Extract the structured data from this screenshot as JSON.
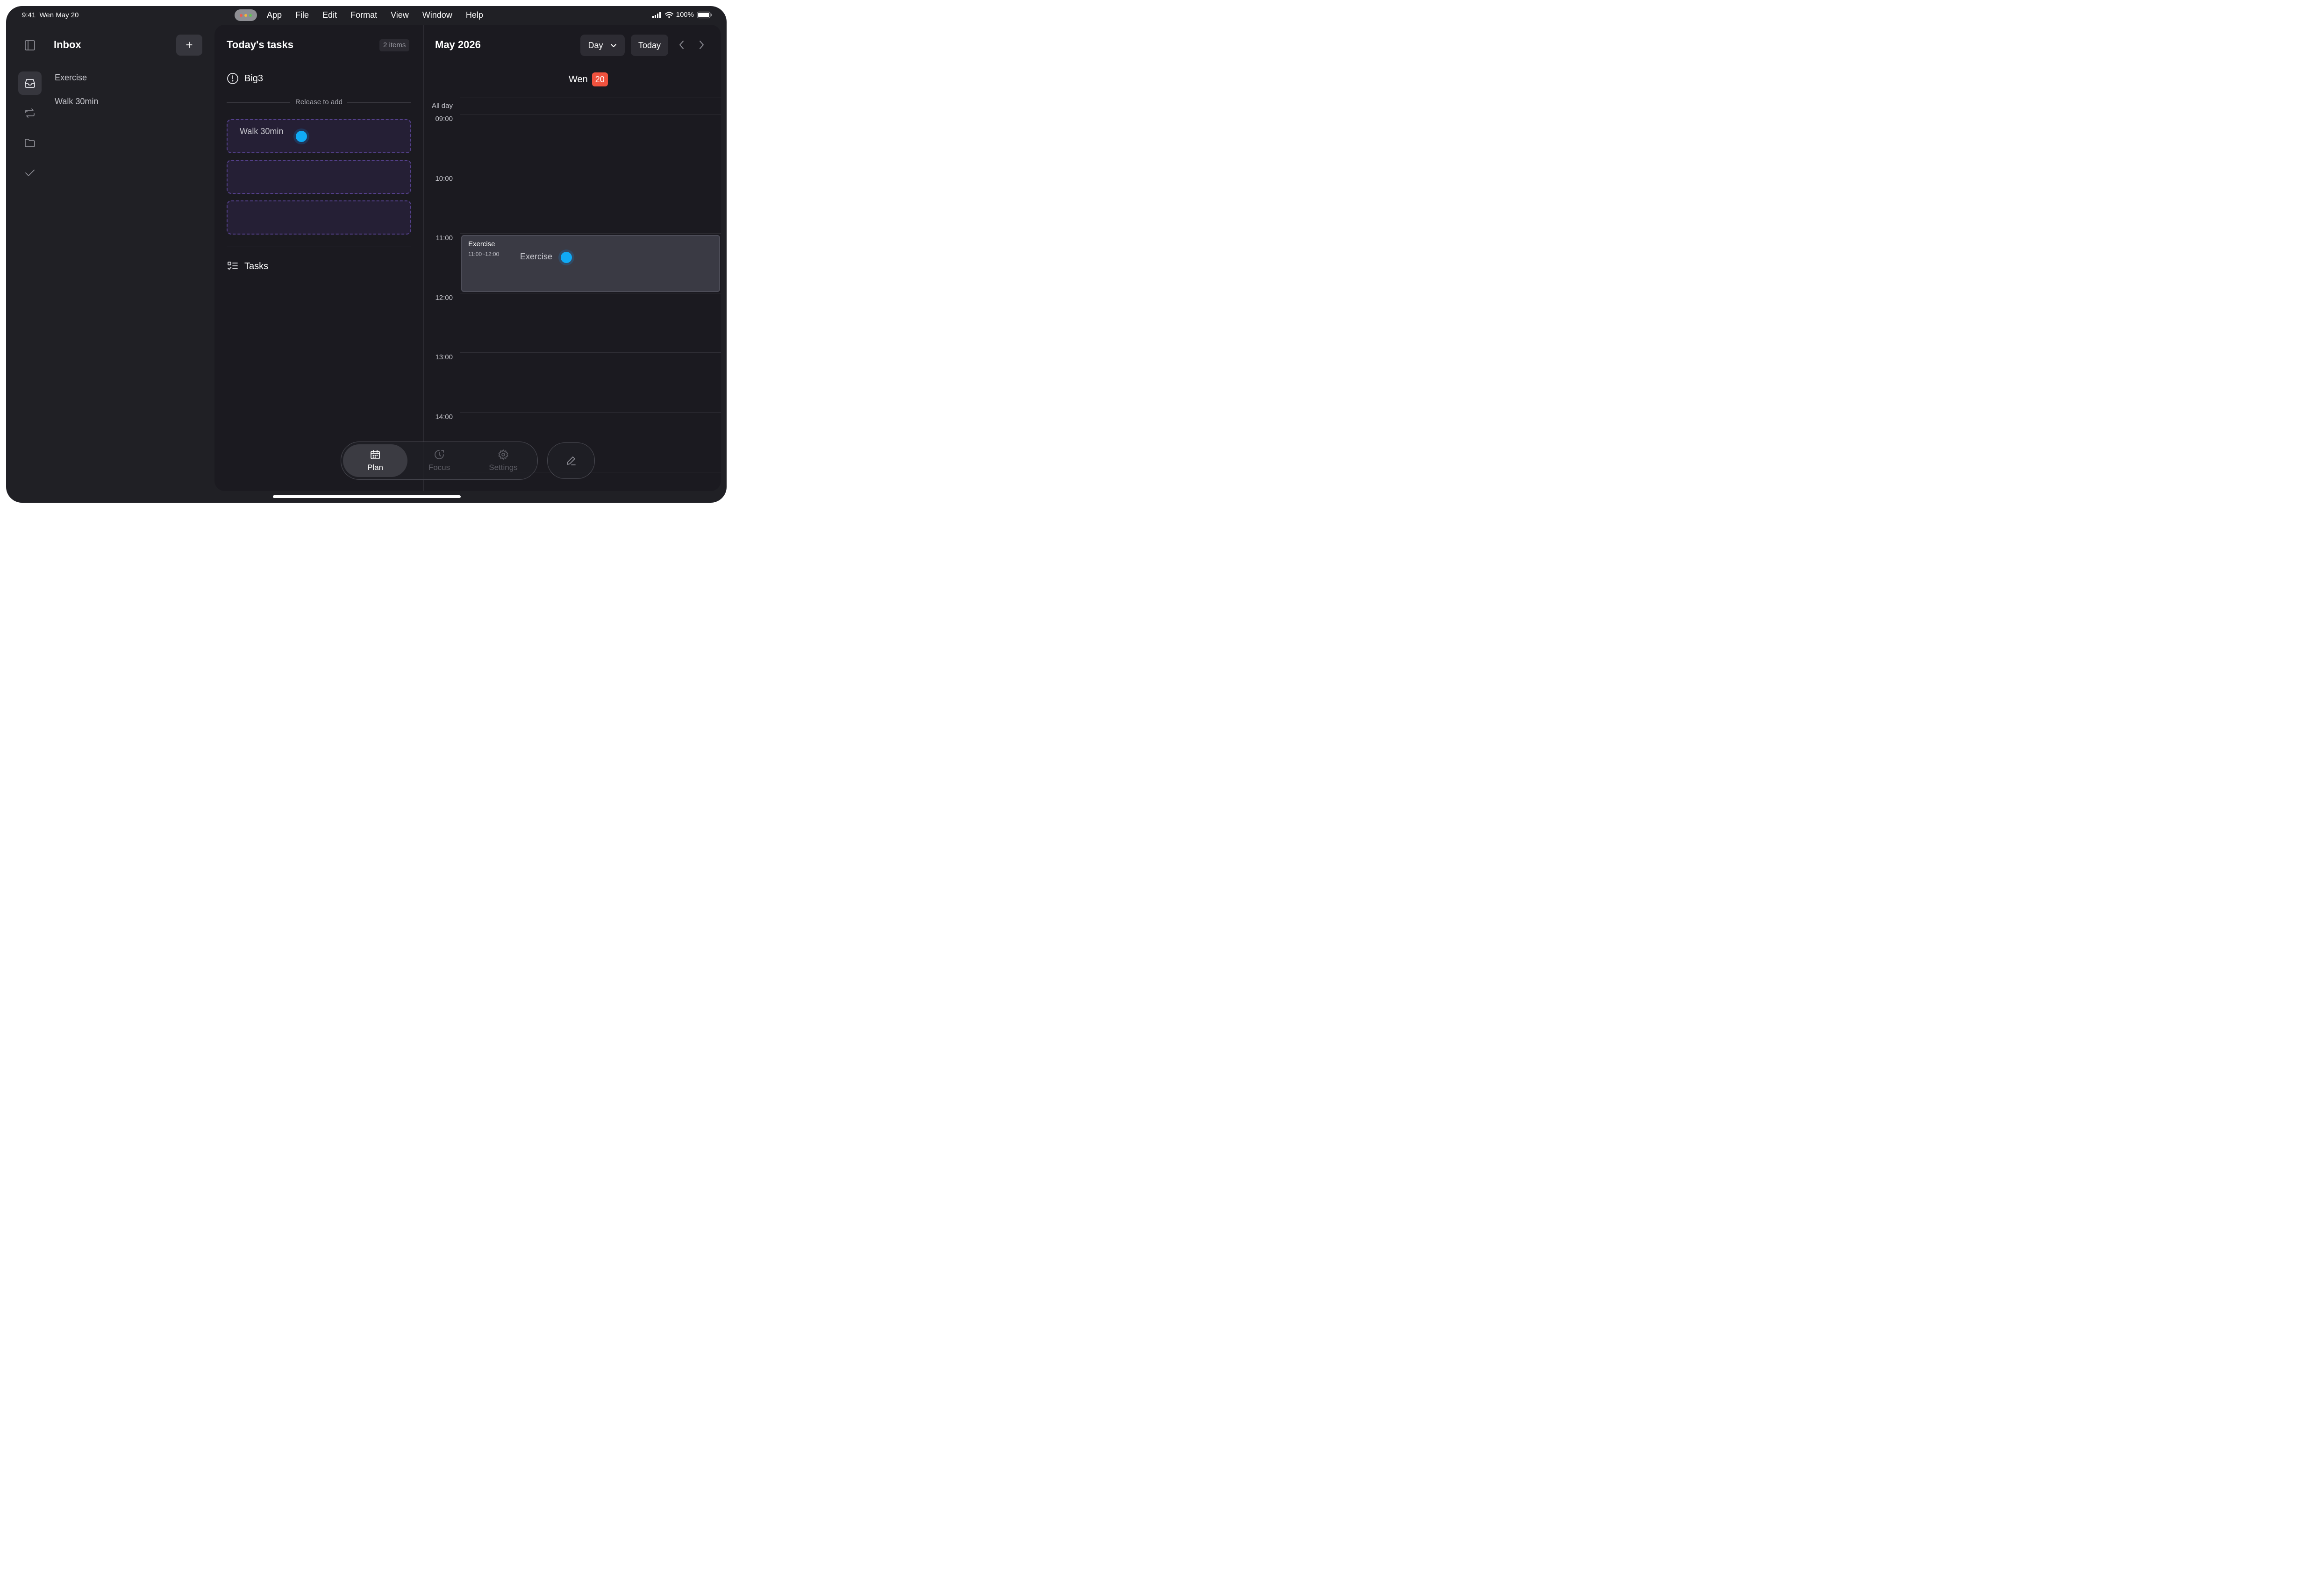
{
  "status": {
    "time": "9:41",
    "date": "Wen May 20",
    "battery": "100%"
  },
  "menu": [
    "App",
    "File",
    "Edit",
    "Format",
    "View",
    "Window",
    "Help"
  ],
  "sidebar": {
    "title": "Inbox",
    "add_label": "+",
    "items": [
      {
        "label": "Exercise"
      },
      {
        "label": "Walk 30min"
      }
    ],
    "rail": [
      "sidebar-toggle-icon",
      "inbox-icon",
      "repeat-icon",
      "folder-icon",
      "check-icon"
    ]
  },
  "tasks_panel": {
    "title": "Today's tasks",
    "count": "2 items",
    "big3": "Big3",
    "release_hint": "Release to add",
    "slots": [
      {
        "label": "Walk 30min"
      },
      {
        "label": ""
      },
      {
        "label": ""
      }
    ],
    "tasks_section": "Tasks"
  },
  "calendar": {
    "month": "May 2026",
    "view": "Day",
    "today_label": "Today",
    "day_name": "Wen",
    "day_number": "20",
    "all_day": "All day",
    "hours": [
      "09:00",
      "10:00",
      "11:00",
      "12:00",
      "13:00",
      "14:00"
    ],
    "event": {
      "title": "Exercise",
      "time": "11:00~12:00",
      "drag_label": "Exercise"
    }
  },
  "tabbar": {
    "tabs": [
      {
        "label": "Plan"
      },
      {
        "label": "Focus"
      },
      {
        "label": "Settings"
      }
    ]
  },
  "colors": {
    "accent_dot": "#10aaf5",
    "today_badge": "#f0523e",
    "dashed_slot": "#54408a"
  }
}
